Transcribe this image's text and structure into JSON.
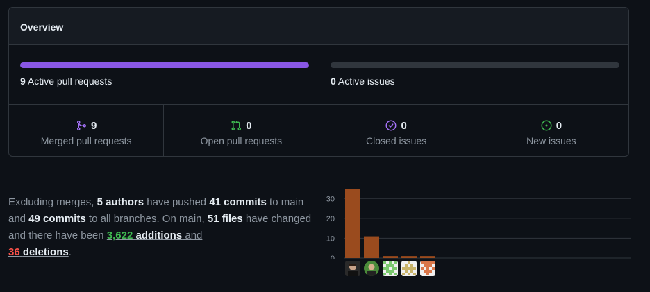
{
  "overview": {
    "title": "Overview",
    "pull_requests_progress": {
      "count": "9",
      "label": "Active pull requests",
      "fill_fraction": 1.0,
      "color": "#8957e5"
    },
    "issues_progress": {
      "count": "0",
      "label": "Active issues",
      "fill_fraction": 0.0,
      "color": "#30363d"
    },
    "stats": [
      {
        "value": "9",
        "label": "Merged pull requests",
        "icon": "merge-icon",
        "color": "#a371f7"
      },
      {
        "value": "0",
        "label": "Open pull requests",
        "icon": "pull-request-icon",
        "color": "#3fb950"
      },
      {
        "value": "0",
        "label": "Closed issues",
        "icon": "issue-closed-icon",
        "color": "#a371f7"
      },
      {
        "value": "0",
        "label": "New issues",
        "icon": "issue-opened-icon",
        "color": "#3fb950"
      }
    ]
  },
  "summary": {
    "p1": "Excluding merges, ",
    "authors": "5 authors",
    "p2": " have pushed ",
    "commits_main": "41 commits",
    "p3": " to main and ",
    "commits_all": "49 commits",
    "p4": " to all branches. On main, ",
    "files": "51 files",
    "p5": " have changed and there have been ",
    "additions_num": "3,622",
    "additions_word": "additions",
    "and_word": "and",
    "deletions_num": "36",
    "deletions_word": "deletions",
    "end": "."
  },
  "chart_data": {
    "type": "bar",
    "categories": [
      "author-1",
      "author-2",
      "author-3",
      "author-4",
      "author-5"
    ],
    "values": [
      35,
      11,
      1,
      1,
      1
    ],
    "ylim": [
      0,
      35
    ],
    "yticks": [
      "0",
      "10",
      "20",
      "30"
    ],
    "bar_color": "#9a4b1e",
    "grid": true
  },
  "contributors": [
    {
      "icon": "avatar-photo-1"
    },
    {
      "icon": "avatar-photo-2"
    },
    {
      "icon": "identicon-green"
    },
    {
      "icon": "identicon-olive"
    },
    {
      "icon": "identicon-orange"
    }
  ]
}
